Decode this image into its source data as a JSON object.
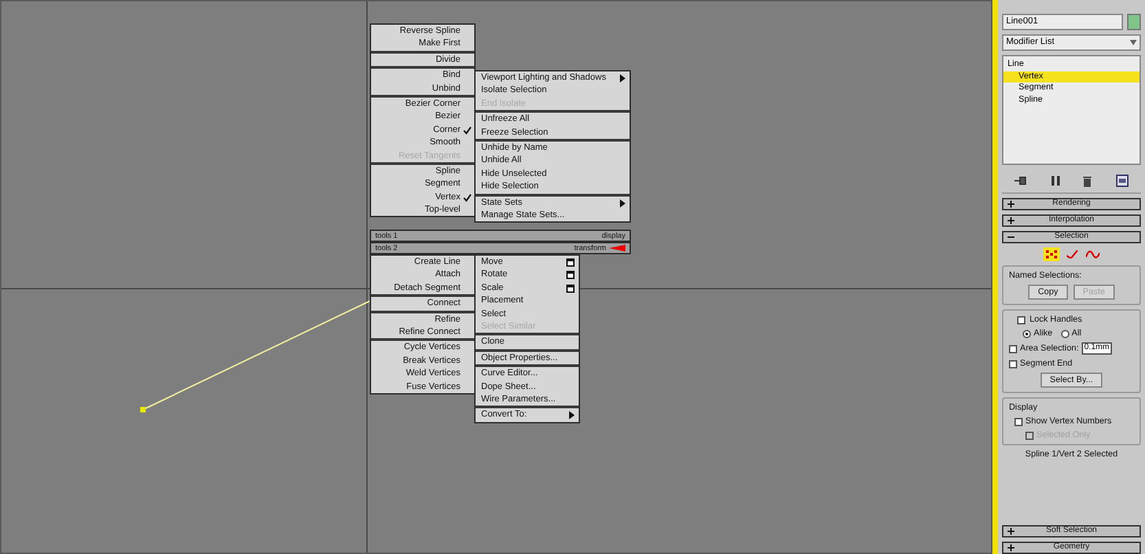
{
  "quad_menu": {
    "top_left": {
      "groups": [
        {
          "items": [
            {
              "label": "Reverse Spline",
              "kind": "item",
              "checked": false,
              "disabled": false
            },
            {
              "label": "Make First",
              "kind": "item",
              "checked": false,
              "disabled": false
            }
          ]
        },
        {
          "items": [
            {
              "label": "Divide",
              "kind": "item",
              "checked": false,
              "disabled": false
            }
          ]
        },
        {
          "items": [
            {
              "label": "Bind",
              "kind": "item",
              "checked": false,
              "disabled": false
            },
            {
              "label": "Unbind",
              "kind": "item",
              "checked": false,
              "disabled": false
            }
          ]
        },
        {
          "items": [
            {
              "label": "Bezier Corner",
              "kind": "item",
              "checked": false,
              "disabled": false
            },
            {
              "label": "Bezier",
              "kind": "item",
              "checked": false,
              "disabled": false
            },
            {
              "label": "Corner",
              "kind": "item",
              "checked": true,
              "disabled": false
            },
            {
              "label": "Smooth",
              "kind": "item",
              "checked": false,
              "disabled": false
            },
            {
              "label": "Reset Tangents",
              "kind": "item",
              "checked": false,
              "disabled": true
            }
          ]
        },
        {
          "items": [
            {
              "label": "Spline",
              "kind": "item",
              "checked": false,
              "disabled": false
            },
            {
              "label": "Segment",
              "kind": "item",
              "checked": false,
              "disabled": false
            },
            {
              "label": "Vertex",
              "kind": "item",
              "checked": true,
              "disabled": false
            },
            {
              "label": "Top-level",
              "kind": "item",
              "checked": false,
              "disabled": false
            }
          ]
        }
      ]
    },
    "top_right": {
      "groups": [
        {
          "items": [
            {
              "label": "Viewport Lighting and Shadows",
              "kind": "submenu",
              "checked": false,
              "disabled": false
            },
            {
              "label": "Isolate Selection",
              "kind": "item",
              "checked": false,
              "disabled": false
            },
            {
              "label": "End Isolate",
              "kind": "item",
              "checked": false,
              "disabled": true
            }
          ]
        },
        {
          "items": [
            {
              "label": "Unfreeze All",
              "kind": "item",
              "checked": false,
              "disabled": false
            },
            {
              "label": "Freeze Selection",
              "kind": "item",
              "checked": false,
              "disabled": false
            }
          ]
        },
        {
          "items": [
            {
              "label": "Unhide by Name",
              "kind": "item",
              "checked": false,
              "disabled": false
            },
            {
              "label": "Unhide All",
              "kind": "item",
              "checked": false,
              "disabled": false
            },
            {
              "label": "Hide Unselected",
              "kind": "item",
              "checked": false,
              "disabled": false
            },
            {
              "label": "Hide Selection",
              "kind": "item",
              "checked": false,
              "disabled": false
            }
          ]
        },
        {
          "items": [
            {
              "label": "State Sets",
              "kind": "submenu",
              "checked": false,
              "disabled": false
            },
            {
              "label": "Manage State Sets...",
              "kind": "item",
              "checked": false,
              "disabled": false
            }
          ]
        }
      ]
    },
    "header_1": {
      "left": "tools 1",
      "right": "display"
    },
    "header_2": {
      "left": "tools 2",
      "right": "transform"
    },
    "bottom_left": {
      "groups": [
        {
          "items": [
            {
              "label": "Create Line",
              "kind": "item",
              "checked": false,
              "disabled": false
            },
            {
              "label": "Attach",
              "kind": "item",
              "checked": false,
              "disabled": false
            },
            {
              "label": "Detach Segment",
              "kind": "item",
              "checked": false,
              "disabled": false
            }
          ]
        },
        {
          "items": [
            {
              "label": "Connect",
              "kind": "item",
              "checked": false,
              "disabled": false
            }
          ]
        },
        {
          "items": [
            {
              "label": "Refine",
              "kind": "item",
              "checked": false,
              "disabled": false
            },
            {
              "label": "Refine Connect",
              "kind": "item",
              "checked": false,
              "disabled": false
            }
          ]
        },
        {
          "items": [
            {
              "label": "Cycle Vertices",
              "kind": "item",
              "checked": false,
              "disabled": false
            },
            {
              "label": "Break Vertices",
              "kind": "item",
              "checked": false,
              "disabled": false
            },
            {
              "label": "Weld Vertices",
              "kind": "item",
              "checked": false,
              "disabled": false
            },
            {
              "label": "Fuse Vertices",
              "kind": "item",
              "checked": false,
              "disabled": false
            }
          ]
        }
      ]
    },
    "bottom_right": {
      "groups": [
        {
          "items": [
            {
              "label": "Move",
              "kind": "options",
              "checked": false,
              "disabled": false
            },
            {
              "label": "Rotate",
              "kind": "options",
              "checked": false,
              "disabled": false
            },
            {
              "label": "Scale",
              "kind": "options",
              "checked": false,
              "disabled": false
            },
            {
              "label": "Placement",
              "kind": "item",
              "checked": false,
              "disabled": false
            },
            {
              "label": "Select",
              "kind": "item",
              "checked": false,
              "disabled": false
            },
            {
              "label": "Select Similar",
              "kind": "item",
              "checked": false,
              "disabled": true
            }
          ]
        },
        {
          "items": [
            {
              "label": "Clone",
              "kind": "item",
              "checked": false,
              "disabled": false
            }
          ]
        },
        {
          "items": [
            {
              "label": "Object Properties...",
              "kind": "item",
              "checked": false,
              "disabled": false
            }
          ]
        },
        {
          "items": [
            {
              "label": "Curve Editor...",
              "kind": "item",
              "checked": false,
              "disabled": false
            },
            {
              "label": "Dope Sheet...",
              "kind": "item",
              "checked": false,
              "disabled": false
            },
            {
              "label": "Wire Parameters...",
              "kind": "item",
              "checked": false,
              "disabled": false
            }
          ]
        },
        {
          "items": [
            {
              "label": "Convert To:",
              "kind": "submenu",
              "checked": false,
              "disabled": false
            }
          ]
        }
      ]
    }
  },
  "panel": {
    "object_name": "Line001",
    "modifier_list": "Modifier List",
    "stack": [
      {
        "label": "Line",
        "selected": false,
        "children": [
          {
            "label": "Vertex",
            "selected": true
          },
          {
            "label": "Segment",
            "selected": false
          },
          {
            "label": "Spline",
            "selected": false
          }
        ]
      }
    ],
    "rollouts_top": [
      {
        "label": "Rendering",
        "expanded": false
      },
      {
        "label": "Interpolation",
        "expanded": false
      },
      {
        "label": "Selection",
        "expanded": true
      }
    ],
    "selection": {
      "levels": [
        {
          "kind": "vertex",
          "selected": true
        },
        {
          "kind": "segment",
          "selected": false
        },
        {
          "kind": "spline",
          "selected": false
        }
      ],
      "named_selections": {
        "title": "Named Selections:",
        "buttons": [
          {
            "label": "Copy",
            "disabled": false
          },
          {
            "label": "Paste",
            "disabled": true
          }
        ]
      },
      "lock_handles": {
        "label": "Lock Handles",
        "checked": false
      },
      "lock_mode": [
        {
          "label": "Alike",
          "selected": true
        },
        {
          "label": "All",
          "selected": false
        }
      ],
      "area_selection": {
        "label": "Area Selection:",
        "checked": false,
        "value": "0.1mm"
      },
      "segment_end": {
        "label": "Segment End",
        "checked": false
      },
      "select_by": "Select By...",
      "display": {
        "title": "Display",
        "options": [
          {
            "label": "Show Vertex Numbers",
            "checked": false,
            "disabled": false
          },
          {
            "label": "Selected Only",
            "checked": false,
            "disabled": true
          }
        ]
      },
      "status": "Spline 1/Vert 2 Selected"
    },
    "rollouts_bottom": [
      {
        "label": "Soft Selection",
        "expanded": false
      },
      {
        "label": "Geometry",
        "expanded": false
      }
    ]
  }
}
